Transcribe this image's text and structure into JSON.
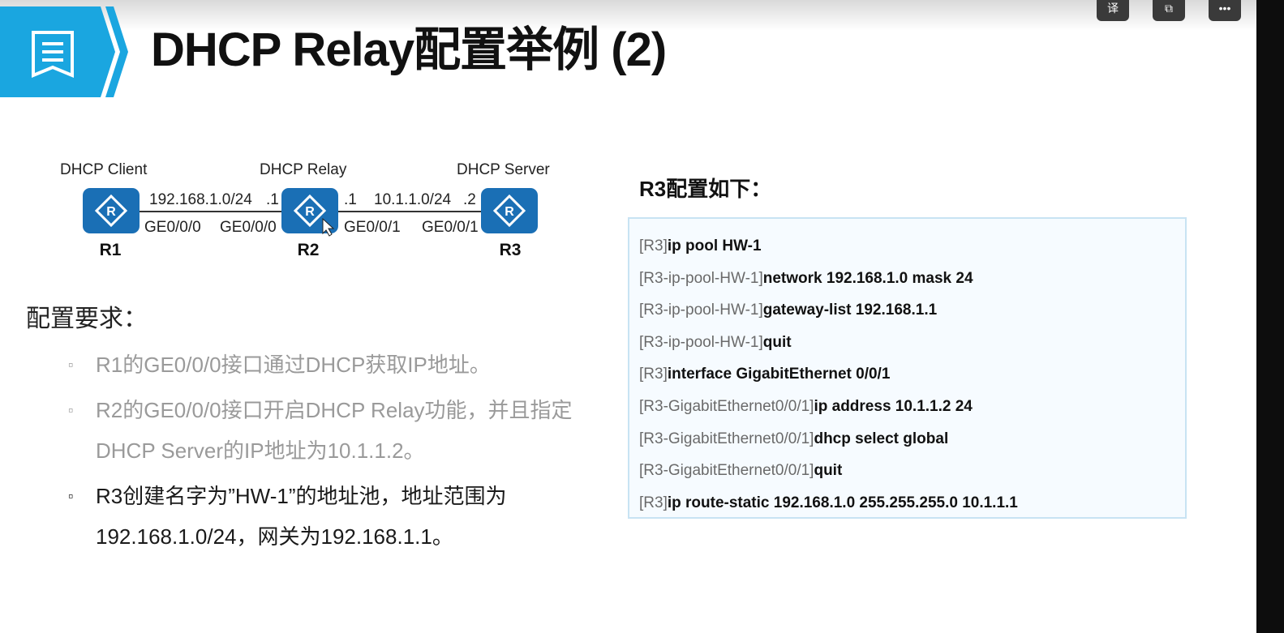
{
  "title": "DHCP Relay配置举例 (2)",
  "player_controls": [
    {
      "icon": "caption-translate-icon",
      "label": "译"
    },
    {
      "icon": "popout-window-icon",
      "label": "⧉"
    },
    {
      "icon": "more-options-icon",
      "label": "•••"
    }
  ],
  "topology": {
    "roles": [
      "DHCP Client",
      "DHCP Relay",
      "DHCP Server"
    ],
    "routers": [
      "R1",
      "R2",
      "R3"
    ],
    "link1": {
      "network": "192.168.1.0/24",
      "r2_suffix": ".1",
      "r1_port": "GE0/0/0",
      "r2_port": "GE0/0/0"
    },
    "link2": {
      "network": "10.1.1.0/24",
      "r2_suffix": ".1",
      "r3_suffix": ".2",
      "r2_port": "GE0/0/1",
      "r3_port": "GE0/0/1"
    },
    "router_color": "#1a6fb5"
  },
  "requirements": {
    "heading": "配置要求：",
    "items": [
      {
        "text": "R1的GE0/0/0接口通过DHCP获取IP地址。",
        "bullet": "▫"
      },
      {
        "text": "R2的GE0/0/0接口开启DHCP Relay功能，并且指定DHCP Server的IP地址为10.1.1.2。",
        "bullet": "▫"
      },
      {
        "text": "R3创建名字为”HW-1”的地址池，地址范围为192.168.1.0/24，网关为192.168.1.1。",
        "bullet": "▫"
      }
    ]
  },
  "config": {
    "heading": "R3配置如下：",
    "lines": [
      {
        "prompt": "[R3]",
        "command": "ip pool HW-1"
      },
      {
        "prompt": "[R3-ip-pool-HW-1]",
        "command": "network 192.168.1.0 mask 24"
      },
      {
        "prompt": "[R3-ip-pool-HW-1]",
        "command": "gateway-list 192.168.1.1"
      },
      {
        "prompt": "[R3-ip-pool-HW-1]",
        "command": "quit"
      },
      {
        "prompt": "[R3]",
        "command": "interface GigabitEthernet 0/0/1"
      },
      {
        "prompt": "[R3-GigabitEthernet0/0/1]",
        "command": "ip address 10.1.1.2 24"
      },
      {
        "prompt": "[R3-GigabitEthernet0/0/1]",
        "command": "dhcp select global"
      },
      {
        "prompt": "[R3-GigabitEthernet0/0/1]",
        "command": "quit"
      },
      {
        "prompt": "[R3]",
        "command": "ip route-static 192.168.1.0 255.255.255.0 10.1.1.1"
      }
    ]
  },
  "colors": {
    "accent": "#1aa6e0",
    "accent_dark": "#0b7fc2"
  }
}
